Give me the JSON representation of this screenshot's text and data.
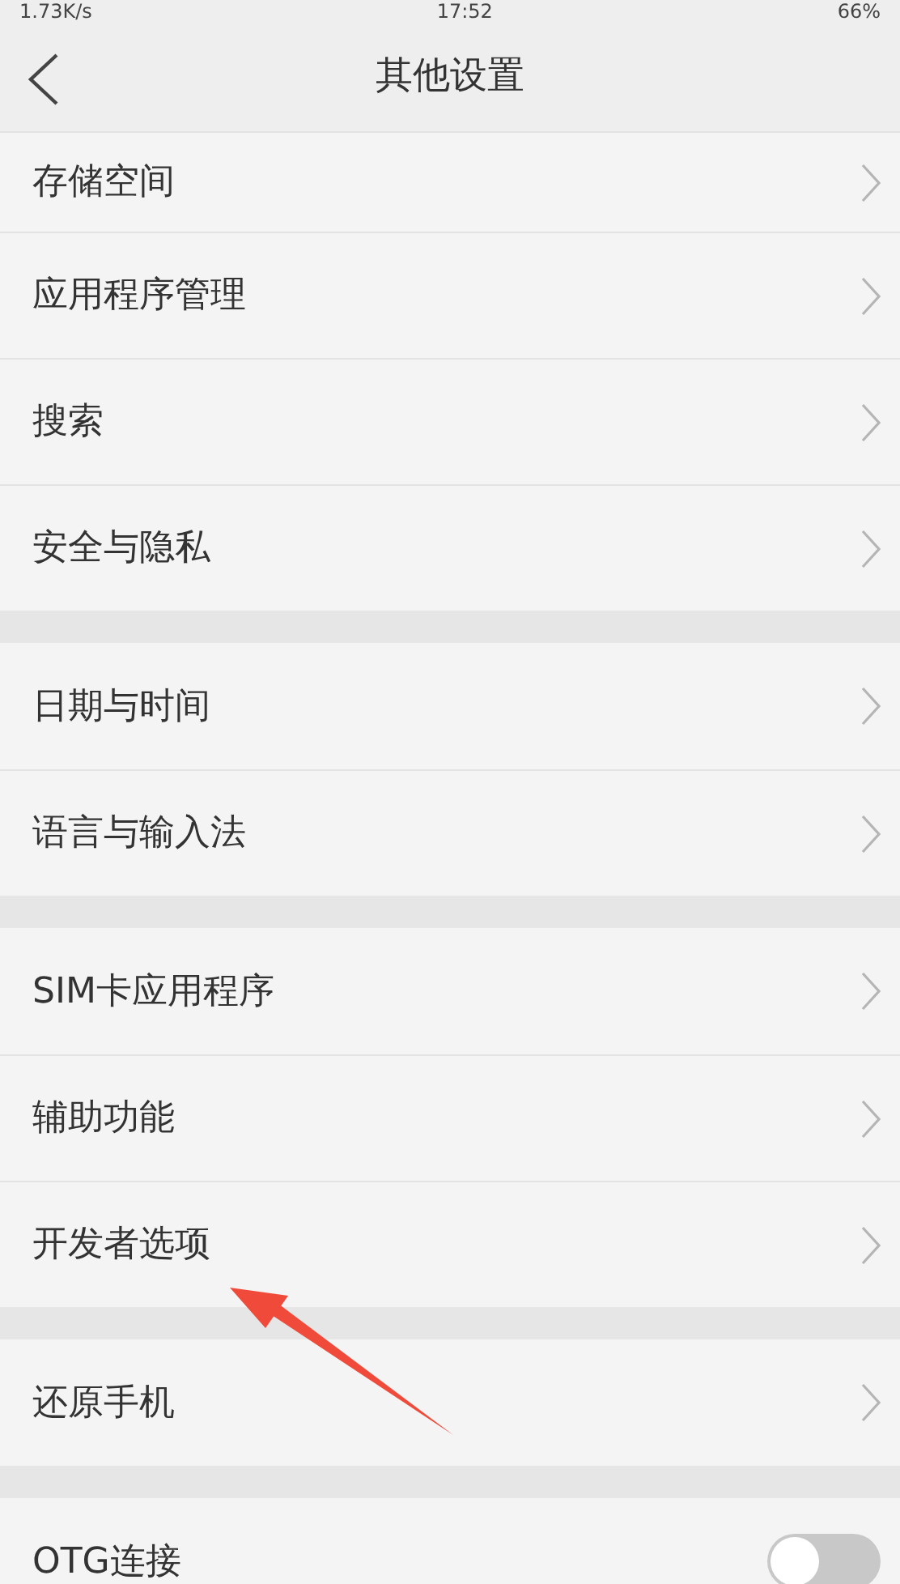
{
  "status_bar": {
    "speed": "1.73K/s",
    "time": "17:52",
    "battery": "66%"
  },
  "header": {
    "title": "其他设置"
  },
  "groups": [
    {
      "items": [
        {
          "label": "存储空间",
          "kind": "link"
        },
        {
          "label": "应用程序管理",
          "kind": "link"
        },
        {
          "label": "搜索",
          "kind": "link"
        },
        {
          "label": "安全与隐私",
          "kind": "link"
        }
      ]
    },
    {
      "items": [
        {
          "label": "日期与时间",
          "kind": "link"
        },
        {
          "label": "语言与输入法",
          "kind": "link"
        }
      ]
    },
    {
      "items": [
        {
          "label": "SIM卡应用程序",
          "kind": "link"
        },
        {
          "label": "辅助功能",
          "kind": "link"
        },
        {
          "label": "开发者选项",
          "kind": "link"
        }
      ]
    },
    {
      "items": [
        {
          "label": "还原手机",
          "kind": "link"
        }
      ]
    },
    {
      "items": [
        {
          "label": "OTG连接",
          "kind": "switch",
          "on": false
        }
      ]
    }
  ]
}
